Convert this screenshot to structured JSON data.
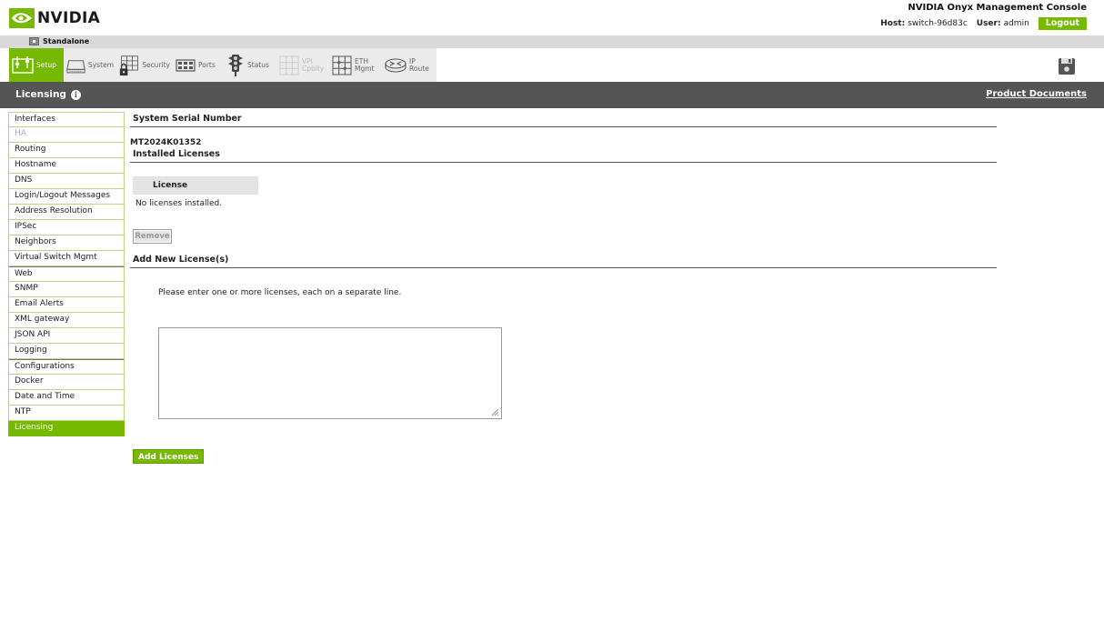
{
  "brand": {
    "name": "NVIDIA"
  },
  "header": {
    "console_title": "NVIDIA Onyx Management Console",
    "host_label": "Host:",
    "host_value": "switch-96d83c",
    "user_label": "User:",
    "user_value": "admin",
    "logout_label": "Logout"
  },
  "mode": {
    "label": "Standalone"
  },
  "toolbar": {
    "items": [
      {
        "label": "Setup",
        "icon": "setup-icon",
        "state": "active"
      },
      {
        "label": "System",
        "icon": "system-icon",
        "state": "normal"
      },
      {
        "label": "Security",
        "icon": "security-icon",
        "state": "normal"
      },
      {
        "label": "Ports",
        "icon": "ports-icon",
        "state": "normal"
      },
      {
        "label": "Status",
        "icon": "status-icon",
        "state": "normal"
      },
      {
        "label": "VPI\nCpblty",
        "icon": "vpi-icon",
        "state": "disabled"
      },
      {
        "label": "ETH\nMgmt",
        "icon": "eth-mgmt-icon",
        "state": "normal"
      },
      {
        "label": "IP\nRoute",
        "icon": "ip-route-icon",
        "state": "normal"
      }
    ],
    "save_icon": "save-icon"
  },
  "section": {
    "title": "Licensing",
    "product_docs": "Product Documents"
  },
  "sidebar": {
    "items": [
      {
        "label": "Interfaces",
        "state": "normal"
      },
      {
        "label": "HA",
        "state": "disabled"
      },
      {
        "label": "Routing",
        "state": "normal"
      },
      {
        "label": "Hostname",
        "state": "normal"
      },
      {
        "label": "DNS",
        "state": "normal"
      },
      {
        "label": "Login/Logout Messages",
        "state": "normal"
      },
      {
        "label": "Address Resolution",
        "state": "normal"
      },
      {
        "label": "IPSec",
        "state": "normal"
      },
      {
        "label": "Neighbors",
        "state": "normal"
      },
      {
        "label": "Virtual Switch Mgmt",
        "state": "normal"
      },
      {
        "label": "Web",
        "state": "normal"
      },
      {
        "label": "SNMP",
        "state": "normal"
      },
      {
        "label": "Email Alerts",
        "state": "normal"
      },
      {
        "label": "XML gateway",
        "state": "normal"
      },
      {
        "label": "JSON API",
        "state": "normal"
      },
      {
        "label": "Logging",
        "state": "normal"
      },
      {
        "label": "Configurations",
        "state": "normal"
      },
      {
        "label": "Docker",
        "state": "normal"
      },
      {
        "label": "Date and Time",
        "state": "normal"
      },
      {
        "label": "NTP",
        "state": "normal"
      },
      {
        "label": "Licensing",
        "state": "active"
      }
    ]
  },
  "main": {
    "serial_heading": "System Serial Number",
    "serial_value": "MT2024K01352",
    "installed_heading": "Installed Licenses",
    "table_header": "License",
    "no_licenses": "No licenses installed.",
    "remove_label": "Remove",
    "add_heading": "Add New License(s)",
    "hint": "Please enter one or more licenses, each on a separate line.",
    "textarea_value": "",
    "add_label": "Add Licenses"
  },
  "colors": {
    "accent": "#76b900",
    "section_bar": "#555555",
    "mode_bar": "#d9d9d9"
  }
}
